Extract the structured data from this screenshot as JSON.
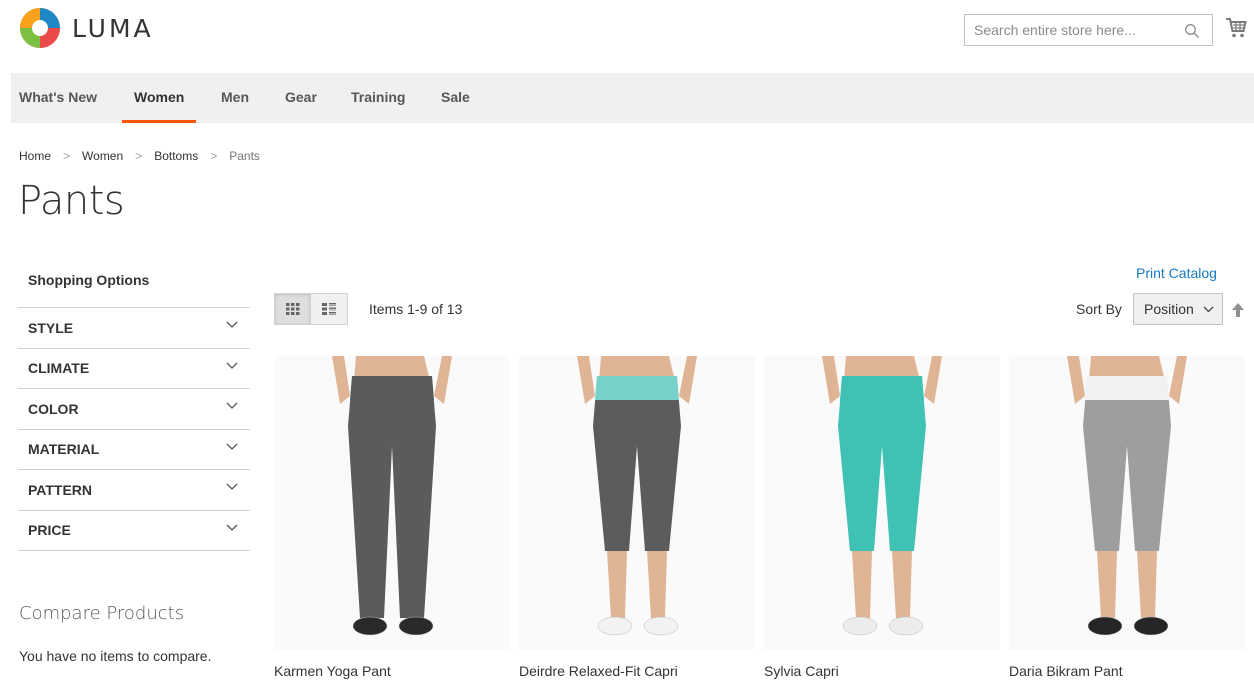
{
  "header": {
    "logo_text": "LUMA",
    "search_placeholder": "Search entire store here...",
    "icons": [
      "logo-icon",
      "search-icon",
      "cart-icon"
    ]
  },
  "nav": {
    "items": [
      {
        "label": "What's New"
      },
      {
        "label": "Women",
        "active": true
      },
      {
        "label": "Men"
      },
      {
        "label": "Gear"
      },
      {
        "label": "Training"
      },
      {
        "label": "Sale"
      }
    ]
  },
  "breadcrumb": {
    "items": [
      "Home",
      "Women",
      "Bottoms",
      "Pants"
    ],
    "separator": ">"
  },
  "page": {
    "title": "Pants"
  },
  "sidebar": {
    "heading": "Shopping Options",
    "filters": [
      "Style",
      "Climate",
      "Color",
      "Material",
      "Pattern",
      "Price"
    ],
    "compare_title": "Compare Products",
    "compare_empty": "You have no items to compare."
  },
  "toolbar": {
    "print_catalog": "Print Catalog",
    "amount": "Items 1-9 of 13",
    "sort_label": "Sort By",
    "sort_value": "Position",
    "view_modes": [
      "grid-view-icon",
      "list-view-icon"
    ],
    "active_mode": "grid"
  },
  "products": [
    {
      "name": "Karmen Yoga Pant",
      "waistband": "#5b5b5b",
      "leg": "#5b5b5b",
      "shoe": "#2a2a2a",
      "length": "full"
    },
    {
      "name": "Deirdre Relaxed-Fit Capri",
      "waistband": "#77d3c9",
      "leg": "#5c5c5c",
      "shoe": "#f2f2f2",
      "length": "capri"
    },
    {
      "name": "Sylvia Capri",
      "waistband": "#3fc1b4",
      "leg": "#3fc1b4",
      "shoe": "#ececec",
      "length": "capri"
    },
    {
      "name": "Daria Bikram Pant",
      "waistband": "#f1f1f1",
      "leg": "#9e9e9e",
      "shoe": "#262626",
      "length": "capri"
    }
  ],
  "colors": {
    "accent": "#ff5501",
    "link": "#1979c3",
    "nav_bg": "#f0f0f0"
  }
}
